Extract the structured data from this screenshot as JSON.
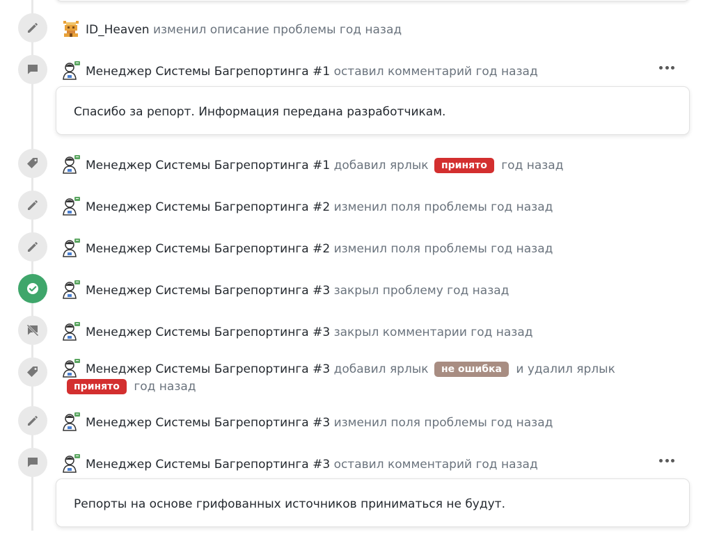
{
  "colors": {
    "label_accepted": "#d32f2f",
    "label_not_bug": "#a88d82",
    "closed_badge": "#3fa66b",
    "badge_bg": "#e9e9e9",
    "icon_gray": "#777777"
  },
  "events": [
    {
      "icon": "pencil-icon",
      "avatar": "pixel-avatar",
      "author": "ID_Heaven",
      "action": "изменил описание проблемы год назад"
    },
    {
      "icon": "comment-icon",
      "avatar": "manager-avatar",
      "author": "Менеджер Системы Багрепортинга #1",
      "action": "оставил комментарий год назад",
      "comment": "Спасибо за репорт. Информация передана разработчикам."
    },
    {
      "icon": "tag-icon",
      "avatar": "manager-avatar",
      "author": "Менеджер Системы Багрепортинга #1",
      "action": "добавил ярлык",
      "label": "принято",
      "after": "год назад"
    },
    {
      "icon": "pencil-icon",
      "avatar": "manager-avatar",
      "author": "Менеджер Системы Багрепортинга #2",
      "action": "изменил поля проблемы год назад"
    },
    {
      "icon": "pencil-icon",
      "avatar": "manager-avatar",
      "author": "Менеджер Системы Багрепортинга #2",
      "action": "изменил поля проблемы год назад"
    },
    {
      "icon": "check-circle-icon",
      "avatar": "manager-avatar",
      "author": "Менеджер Системы Багрепортинга #3",
      "action": "закрыл проблему год назад"
    },
    {
      "icon": "comment-lock-icon",
      "avatar": "manager-avatar",
      "author": "Менеджер Системы Багрепортинга #3",
      "action": "закрыл комментарии год назад"
    },
    {
      "icon": "tag-icon",
      "avatar": "manager-avatar",
      "author": "Менеджер Системы Багрепортинга #3",
      "action": "добавил ярлык",
      "label_added": "не ошибка",
      "middle": "и удалил ярлык",
      "label_removed": "принято",
      "after": "год назад"
    },
    {
      "icon": "pencil-icon",
      "avatar": "manager-avatar",
      "author": "Менеджер Системы Багрепортинга #3",
      "action": "изменил поля проблемы год назад"
    },
    {
      "icon": "comment-icon",
      "avatar": "manager-avatar",
      "author": "Менеджер Системы Багрепортинга #3",
      "action": "оставил комментарий год назад",
      "comment": "Репорты на основе грифованных источников приниматься не будут."
    }
  ]
}
